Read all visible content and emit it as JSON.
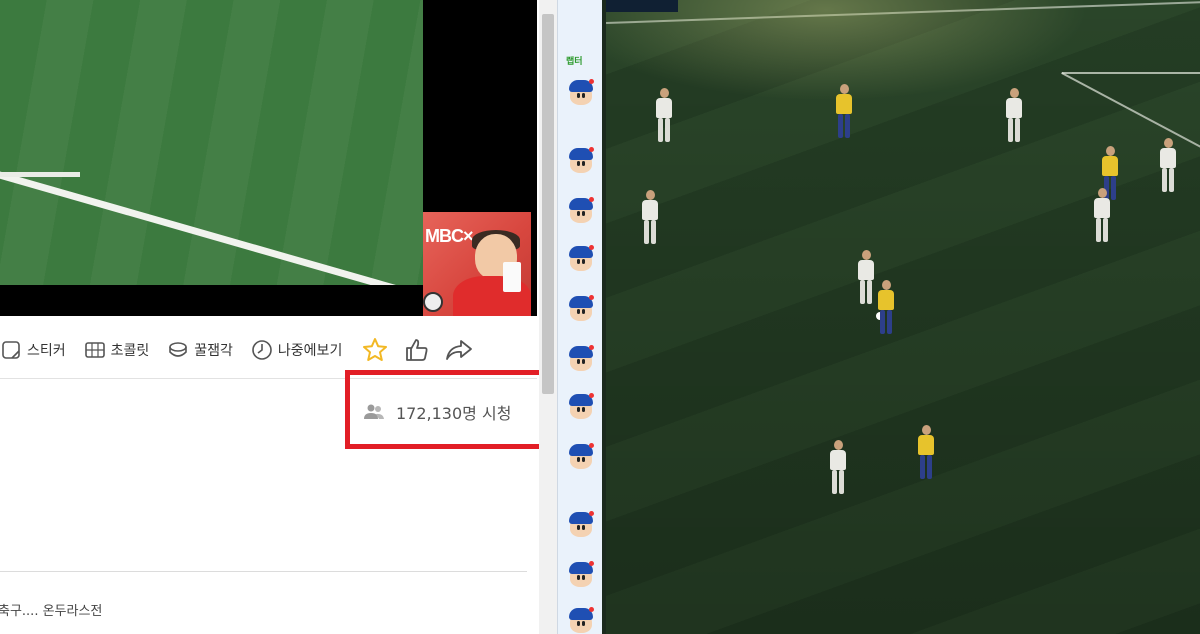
{
  "broadcast": {
    "pip_brand": "MBC×"
  },
  "toolbar": {
    "items": [
      {
        "label": "스티커",
        "icon": "sticker-icon"
      },
      {
        "label": "초콜릿",
        "icon": "chocolate-icon"
      },
      {
        "label": "꿀잼각",
        "icon": "honey-icon"
      },
      {
        "label": "나중에보기",
        "icon": "clock-icon"
      }
    ],
    "favorite_icon": "star-icon",
    "like_icon": "thumbs-up-icon",
    "share_icon": "share-icon"
  },
  "viewers": {
    "icon": "people-icon",
    "text": "172,130명 시청"
  },
  "related": {
    "text": "축구.... 온두라스전"
  },
  "chat": {
    "username": "랩터",
    "emote_icon": "cartoon-face-emoticon"
  },
  "colors": {
    "highlight_border": "#e21e26",
    "star": "#f2b824",
    "chat_bg": "#eaf2fb"
  }
}
